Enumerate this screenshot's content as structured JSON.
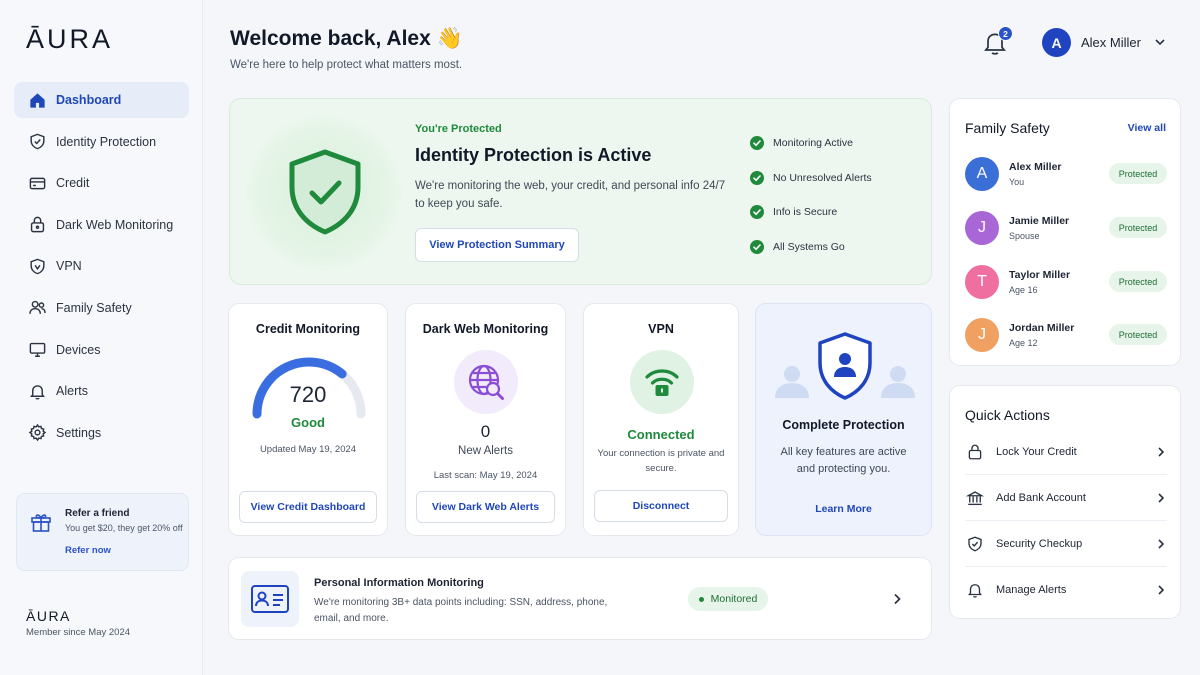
{
  "brand": {
    "logo": "ĀURA",
    "logo_small": "ĀURA",
    "member_since": "Member since May 2024"
  },
  "nav": [
    {
      "label": "Dashboard",
      "icon": "home-icon",
      "active": true
    },
    {
      "label": "Identity Protection",
      "icon": "shield-check-icon"
    },
    {
      "label": "Credit",
      "icon": "credit-card-icon"
    },
    {
      "label": "Dark Web Monitoring",
      "icon": "lock-icon"
    },
    {
      "label": "VPN",
      "icon": "vpn-shield-icon"
    },
    {
      "label": "Family Safety",
      "icon": "users-icon"
    },
    {
      "label": "Devices",
      "icon": "monitor-icon"
    },
    {
      "label": "Alerts",
      "icon": "bell-icon"
    },
    {
      "label": "Settings",
      "icon": "gear-icon"
    }
  ],
  "refer": {
    "title": "Refer a friend",
    "desc": "You get $20, they get 20% off",
    "link": "Refer now"
  },
  "header": {
    "welcome": "Welcome back, Alex 👋",
    "subtitle": "We're here to help protect what matters most.",
    "notifications": "2",
    "user_initial": "A",
    "user_name": "Alex Miller"
  },
  "hero": {
    "eyebrow": "You're Protected",
    "title": "Identity Protection is Active",
    "desc": "We're monitoring the web, your credit, and personal info 24/7 to keep you safe.",
    "button": "View Protection Summary",
    "checks": [
      "Monitoring Active",
      "No Unresolved Alerts",
      "Info is Secure",
      "All Systems Go"
    ]
  },
  "credit": {
    "title": "Credit Monitoring",
    "score": "720",
    "rating": "Good",
    "updated": "Updated May 19, 2024",
    "button": "View Credit Dashboard",
    "gauge_fraction": 0.72
  },
  "darkweb": {
    "title": "Dark Web Monitoring",
    "count": "0",
    "label": "New Alerts",
    "last_scan": "Last scan: May 19, 2024",
    "button": "View Dark Web Alerts"
  },
  "vpn": {
    "title": "VPN",
    "status": "Connected",
    "desc": "Your connection is private and secure.",
    "button": "Disconnect"
  },
  "complete": {
    "title": "Complete Protection",
    "desc": "All key features are active and protecting you.",
    "link": "Learn More"
  },
  "pim": {
    "title": "Personal Information Monitoring",
    "desc": "We're monitoring 3B+ data points including: SSN, address, phone, email, and more.",
    "badge": "Monitored"
  },
  "family": {
    "title": "Family Safety",
    "view_all": "View all",
    "members": [
      {
        "initial": "A",
        "name": "Alex Miller",
        "role": "You",
        "status": "Protected",
        "color": "#3b6fd8"
      },
      {
        "initial": "J",
        "name": "Jamie Miller",
        "role": "Spouse",
        "status": "Protected",
        "color": "#a866d6"
      },
      {
        "initial": "T",
        "name": "Taylor Miller",
        "role": "Age 16",
        "status": "Protected",
        "color": "#ef6fa0"
      },
      {
        "initial": "J",
        "name": "Jordan Miller",
        "role": "Age 12",
        "status": "Protected",
        "color": "#f0a060"
      }
    ]
  },
  "quick_actions": {
    "title": "Quick Actions",
    "items": [
      {
        "label": "Lock Your Credit",
        "icon": "lock-icon"
      },
      {
        "label": "Add Bank Account",
        "icon": "bank-icon"
      },
      {
        "label": "Security Checkup",
        "icon": "shield-check-icon"
      },
      {
        "label": "Manage Alerts",
        "icon": "bell-icon"
      }
    ]
  },
  "colors": {
    "accent": "#1f47b8",
    "success": "#1f8a3b",
    "hero_bg": "#edf7ef"
  }
}
